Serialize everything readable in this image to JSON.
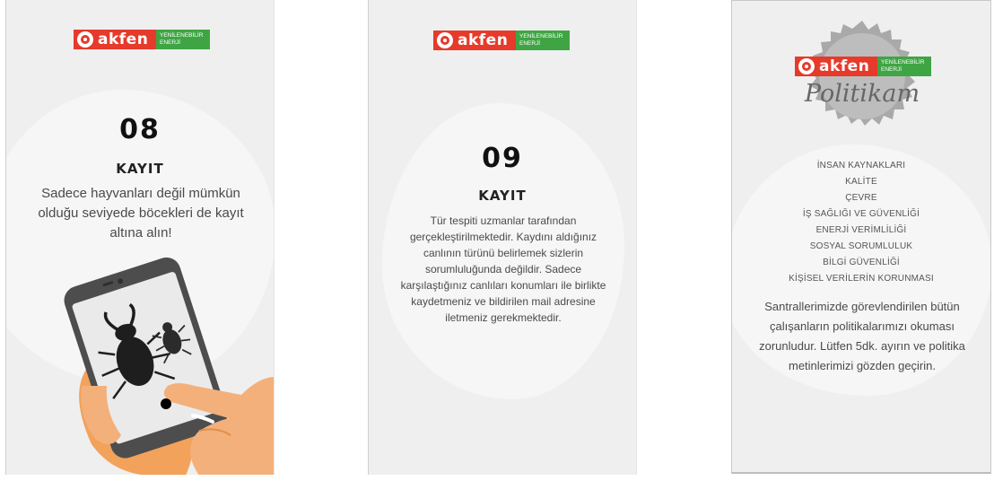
{
  "brand": {
    "logo_word": "akfen",
    "logo_tag_line1": "YENİLENEBİLİR",
    "logo_tag_line2": "ENERJİ",
    "red": "#e63a2b",
    "green": "#3fa544"
  },
  "cards": [
    {
      "number": "08",
      "heading": "KAYIT",
      "body": "Sadece hayvanları değil mümkün olduğu seviyede böcekleri de kayıt altına alın!",
      "illustration": "hand-holding-phone-with-beetles"
    },
    {
      "number": "09",
      "heading": "KAYIT",
      "body": "Tür tespiti uzmanlar tarafından gerçekleştirilmektedir. Kaydını aldığınız canlının türünü belirlemek sizlerin sorumluluğunda değildir. Sadece karşılaştığınız canlıları konumları ile birlikte kaydetmeniz ve bildirilen mail adresine iletmeniz gerekmektedir."
    },
    {
      "badge_text": "Politikam",
      "policies": [
        "İNSAN KAYNAKLARI",
        "KALİTE",
        "ÇEVRE",
        "İŞ SAĞLIĞI VE GÜVENLİĞİ",
        "ENERJİ VERİMLİLİĞİ",
        "SOSYAL SORUMLULUK",
        "BİLGİ GÜVENLİĞİ",
        "KİŞİSEL VERİLERİN KORUNMASI"
      ],
      "body": "Santrallerimizde görevlendirilen bütün çalışanların politikalarımızı okuması zorunludur. Lütfen 5dk. ayırın ve politika metinlerimizi gözden geçirin."
    }
  ]
}
